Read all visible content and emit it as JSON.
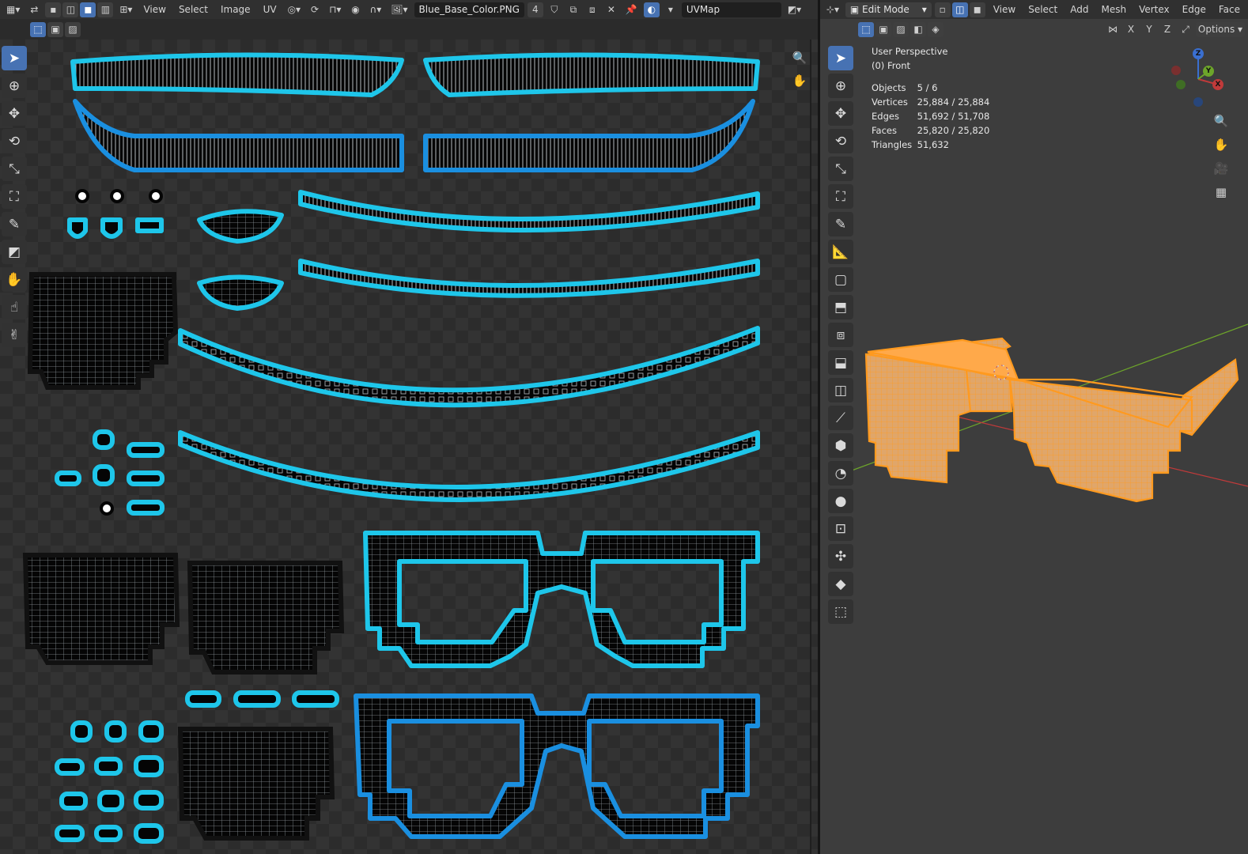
{
  "uv_header": {
    "menus": [
      "View",
      "Select",
      "Image",
      "UV"
    ],
    "image_name": "Blue_Base_Color.PNG",
    "users": "4",
    "uvmap": "UVMap"
  },
  "viewport_header": {
    "mode": "Edit Mode",
    "menus": [
      "View",
      "Select",
      "Add",
      "Mesh",
      "Vertex",
      "Edge",
      "Face"
    ],
    "axes": [
      "X",
      "Y",
      "Z"
    ],
    "options": "Options"
  },
  "overlay": {
    "view_name": "User Perspective",
    "object_name": "(0) Front",
    "stats": [
      {
        "label": "Objects",
        "value": "5 / 6"
      },
      {
        "label": "Vertices",
        "value": "25,884 / 25,884"
      },
      {
        "label": "Edges",
        "value": "51,692 / 51,708"
      },
      {
        "label": "Faces",
        "value": "25,820 / 25,820"
      },
      {
        "label": "Triangles",
        "value": "51,632"
      }
    ]
  },
  "gizmo": {
    "x": "X",
    "y": "Y",
    "z": "Z"
  },
  "colors": {
    "uv_outline": "#1ec6ea",
    "uv_fill": "#050505",
    "uv_wire": "#9aa3a8",
    "selection_orange": "#ff9a1f",
    "active_blue": "#4772b3",
    "axis_red": "#c03a3a",
    "axis_green": "#6da52a",
    "axis_blue": "#3a6fd0"
  }
}
